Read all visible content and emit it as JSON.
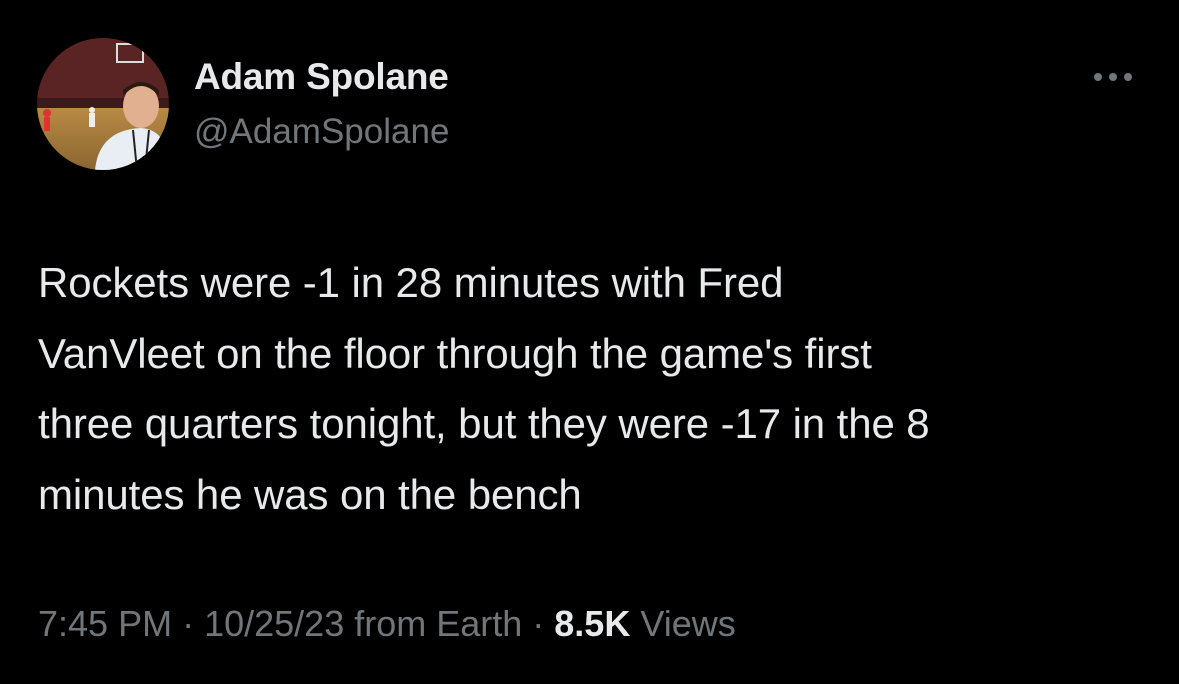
{
  "author": {
    "display_name": "Adam Spolane",
    "handle": "@AdamSpolane",
    "avatar_icon": "profile-photo-icon"
  },
  "menu": {
    "more_icon": "more-horizontal-icon"
  },
  "tweet": {
    "text": "Rockets were -1 in 28 minutes with Fred\nVanVleet on the floor through the game's first\nthree quarters tonight, but they were -17 in the 8\nminutes he was on the bench"
  },
  "meta": {
    "time": "7:45 PM",
    "date": "10/25/23",
    "source": "from Earth",
    "separator": "·",
    "views_count": "8.5K",
    "views_label": "Views"
  },
  "colors": {
    "background": "#000000",
    "primary_text": "#e7e9ea",
    "secondary_text": "#71767b"
  }
}
